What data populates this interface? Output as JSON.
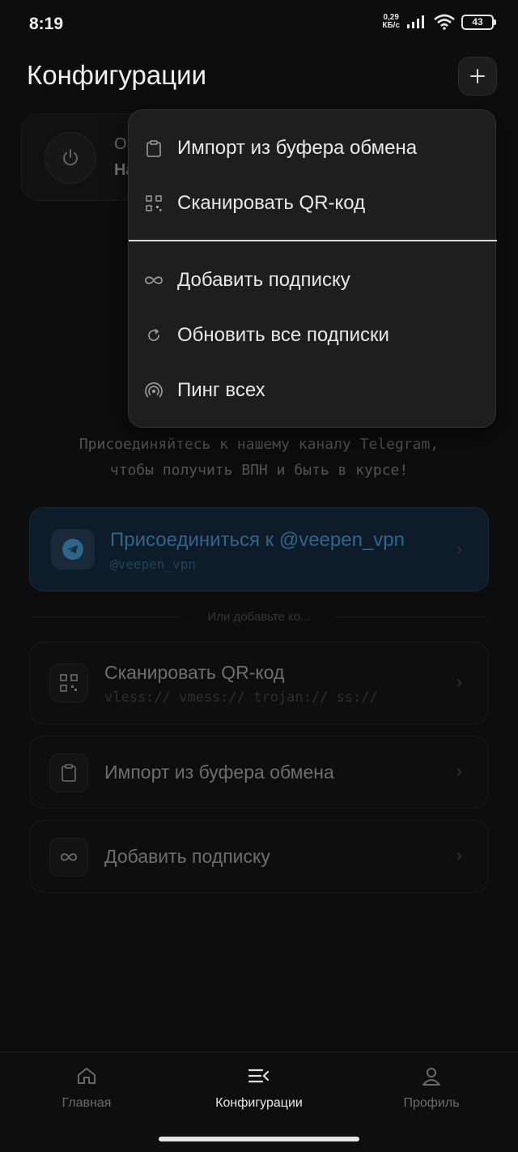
{
  "status_bar": {
    "time": "8:19",
    "net_speed_value": "0,29",
    "net_speed_unit": "КБ/с",
    "battery": "43"
  },
  "header": {
    "title": "Конфигурации",
    "add_button_icon": "plus-icon"
  },
  "connect_card": {
    "title_partial": "О",
    "subtitle_partial": "На"
  },
  "promo": {
    "line1": "Присоединяйтесь к нашему каналу Telegram,",
    "line2": "чтобы получить ВПН и быть в курсе!"
  },
  "telegram_card": {
    "title": "Присоединиться к @veepen_vpn",
    "handle": "@veepen_vpn",
    "icon": "telegram-icon",
    "accent": "#4fb0f5"
  },
  "divider": {
    "text": "Или добавьте ко..."
  },
  "options": [
    {
      "title": "Сканировать QR-код",
      "subtitle": "vless:// vmess:// trojan:// ss://",
      "icon": "qr-icon"
    },
    {
      "title": "Импорт из буфера обмена",
      "icon": "clipboard-icon"
    },
    {
      "title": "Добавить подписку",
      "icon": "infinity-icon"
    }
  ],
  "menu": {
    "items": [
      {
        "label": "Импорт из буфера обмена",
        "icon": "clipboard-icon"
      },
      {
        "label": "Сканировать QR-код",
        "icon": "qr-icon"
      },
      {
        "label": "Добавить подписку",
        "icon": "infinity-icon"
      },
      {
        "label": "Обновить все подписки",
        "icon": "refresh-icon"
      },
      {
        "label": "Пинг всех",
        "icon": "signal-icon"
      }
    ]
  },
  "bottom_nav": {
    "items": [
      {
        "label": "Главная",
        "icon": "home-icon",
        "active": false
      },
      {
        "label": "Конфигурации",
        "icon": "list-icon",
        "active": true
      },
      {
        "label": "Профиль",
        "icon": "user-icon",
        "active": false
      }
    ]
  }
}
